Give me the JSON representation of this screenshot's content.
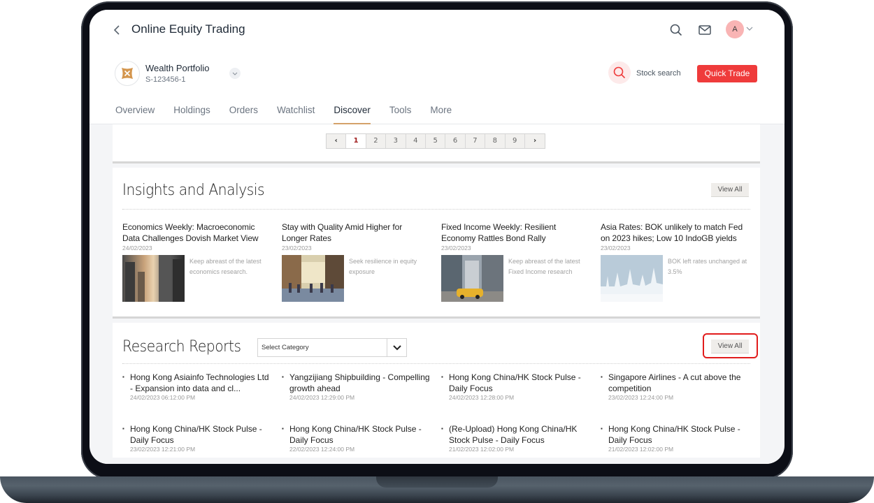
{
  "header": {
    "title": "Online Equity Trading",
    "avatar_initial": "A"
  },
  "portfolio": {
    "name": "Wealth Portfolio",
    "id": "S-123456-1"
  },
  "actions": {
    "stock_search_label": "Stock search",
    "quick_trade_label": "Quick Trade"
  },
  "tabs": [
    {
      "label": "Overview",
      "active": false
    },
    {
      "label": "Holdings",
      "active": false
    },
    {
      "label": "Orders",
      "active": false
    },
    {
      "label": "Watchlist",
      "active": false
    },
    {
      "label": "Discover",
      "active": true
    },
    {
      "label": "Tools",
      "active": false
    },
    {
      "label": "More",
      "active": false
    }
  ],
  "pagination": {
    "prev": "‹",
    "next": "›",
    "pages": [
      "1",
      "2",
      "3",
      "4",
      "5",
      "6",
      "7",
      "8",
      "9"
    ],
    "current": "1"
  },
  "insights": {
    "title": "Insights and Analysis",
    "view_all_label": "View All",
    "items": [
      {
        "title": "Economics Weekly: Macroeconomic Data Challenges Dovish Market View",
        "date": "24/02/2023",
        "description": "Keep abreast of the latest economics research.",
        "image": "city-skyscrapers-image"
      },
      {
        "title": "Stay with Quality Amid Higher for Longer Rates",
        "date": "23/02/2023",
        "description": "Seek resilience in equity exposure",
        "image": "city-street-crowd-image"
      },
      {
        "title": "Fixed Income Weekly: Resilient Economy Rattles Bond Rally",
        "date": "23/02/2023",
        "description": "Keep abreast of the latest Fixed Income research",
        "image": "yellow-taxi-street-image"
      },
      {
        "title": "Asia Rates: BOK unlikely to match Fed on 2023 hikes; Low 10 IndoGB yields",
        "date": "23/02/2023",
        "description": "BOK left rates unchanged at 3.5%",
        "image": "paper-skyline-image"
      }
    ]
  },
  "reports": {
    "title": "Research Reports",
    "category_select": {
      "value": "Select Category"
    },
    "view_all_label": "View All",
    "items": [
      {
        "title": "Hong Kong Asiainfo Technologies Ltd - Expansion into data and cl...",
        "date": "24/02/2023 06:12:00 PM"
      },
      {
        "title": "Yangzijiang Shipbuilding - Compelling growth ahead",
        "date": "24/02/2023 12:29:00 PM"
      },
      {
        "title": "Hong Kong China/HK Stock Pulse - Daily Focus",
        "date": "24/02/2023 12:28:00 PM"
      },
      {
        "title": "Singapore Airlines - A cut above the competition",
        "date": "23/02/2023 12:24:00 PM"
      },
      {
        "title": "Hong Kong China/HK Stock Pulse - Daily Focus",
        "date": "23/02/2023 12:21:00 PM"
      },
      {
        "title": "Hong Kong China/HK Stock Pulse - Daily Focus",
        "date": "22/02/2023 12:24:00 PM"
      },
      {
        "title": "(Re-Upload) Hong Kong China/HK Stock Pulse - Daily Focus",
        "date": "21/02/2023 12:02:00 PM"
      },
      {
        "title": "Hong Kong China/HK Stock Pulse - Daily Focus",
        "date": "21/02/2023 12:02:00 PM"
      }
    ]
  },
  "colors": {
    "brand_red": "#ef3b3b",
    "tab_underline": "#d4a26a",
    "highlight": "#e11c1c",
    "logo_gold": "#d4964e"
  }
}
